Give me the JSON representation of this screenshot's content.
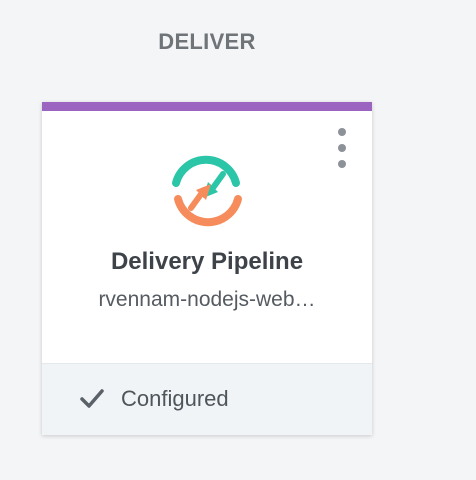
{
  "section": {
    "title": "DELIVER"
  },
  "card": {
    "title": "Delivery Pipeline",
    "subtitle": "rvennam-nodejs-web…",
    "status": "Configured",
    "accent_color": "#9b64c1",
    "icon": "delivery-pipeline-icon",
    "menu_icon": "kebab-menu-icon",
    "status_icon": "checkmark-icon"
  },
  "colors": {
    "icon_teal": "#2bc5a8",
    "icon_orange": "#f68c5b"
  }
}
